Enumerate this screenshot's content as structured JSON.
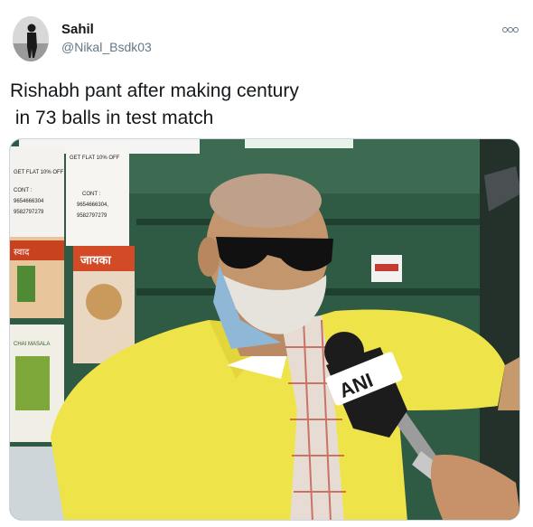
{
  "user": {
    "display_name": "Sahil",
    "handle": "@Nikal_Bsdk03",
    "avatar_icon": "profile-photo"
  },
  "menu": {
    "icon": "more-options-icon"
  },
  "tweet": {
    "text": "Rishabh pant after making century\n in 73 balls in test match"
  },
  "media": {
    "mic_logo": "ANI",
    "poster_left": [
      "GET FLAT 10% OFF",
      "CONT :",
      "9654666304",
      "9582797279"
    ],
    "poster_mid": [
      "GET FLAT 10% OFF",
      "CONT :",
      "9654666304,",
      "9582797279"
    ],
    "shop_banner": "जायका",
    "shop_sub": "स्वाद",
    "chai_label": "CHAI MASALA"
  },
  "colors": {
    "shop_wall": "#2f5a43",
    "shirt": "#efe34a",
    "mic": "#1c1c1c"
  }
}
